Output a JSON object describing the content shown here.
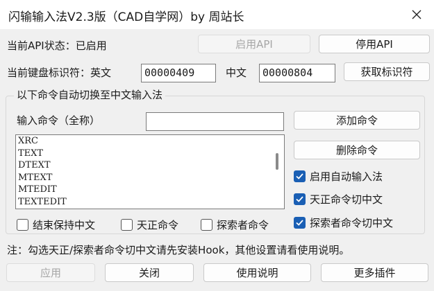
{
  "window": {
    "title": "闪输输入法V2.3版（CAD自学网）by 周站长"
  },
  "api": {
    "status_label": "当前API状态：已启用",
    "enable_label": "启用API",
    "disable_label": "停用API"
  },
  "keyboard": {
    "label_prefix": "当前键盘标识符：英文",
    "english_value": "00000409",
    "chinese_label": "中文",
    "chinese_value": "00000804",
    "get_button": "获取标识符"
  },
  "group": {
    "title": "以下命令自动切换至中文输入法",
    "input_label": "输入命令（全称）",
    "input_value": "",
    "add_button": "添加命令",
    "delete_button": "删除命令",
    "commands": [
      "XRC",
      "TEXT",
      "DTEXT",
      "MTEXT",
      "MTEDIT",
      "TEXTEDIT"
    ]
  },
  "options": {
    "auto_input": {
      "label": "启用自动输入法",
      "checked": true
    },
    "tianzheng_switch": {
      "label": "天正命令切中文",
      "checked": true
    },
    "explorer_switch": {
      "label": "探索者命令切中文",
      "checked": true
    },
    "end_keep_chinese": {
      "label": "结束保持中文",
      "checked": false
    },
    "tianzheng_cmd": {
      "label": "天正命令",
      "checked": false
    },
    "explorer_cmd": {
      "label": "探索者命令",
      "checked": false
    }
  },
  "note": "注：勾选天正/探索者命令切中文请先安装Hook，其他设置请看使用说明。",
  "footer": {
    "apply": "应用",
    "close": "关闭",
    "manual": "使用说明",
    "more": "更多插件"
  },
  "colors": {
    "accent": "#1a5fb4",
    "window_bg": "#f0f0f0"
  }
}
